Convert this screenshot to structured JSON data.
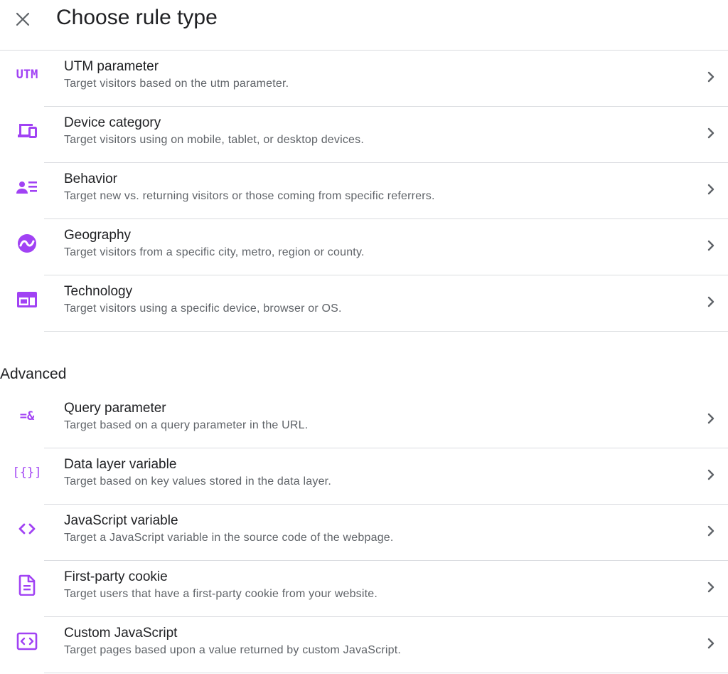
{
  "dialog": {
    "title": "Choose rule type",
    "close_icon": "close-icon"
  },
  "accent_color": "#a142f4",
  "rules": [
    {
      "icon": "utm-icon",
      "icon_text": "UTM",
      "title": "UTM parameter",
      "description": "Target visitors based on the utm parameter."
    },
    {
      "icon": "devices-icon",
      "title": "Device category",
      "description": "Target visitors using on mobile, tablet, or desktop devices."
    },
    {
      "icon": "person-list-icon",
      "title": "Behavior",
      "description": "Target new vs. returning visitors or those coming from specific referrers."
    },
    {
      "icon": "globe-icon",
      "title": "Geography",
      "description": "Target visitors from a specific city, metro, region or county."
    },
    {
      "icon": "browser-window-icon",
      "title": "Technology",
      "description": "Target visitors using a specific device, browser or OS."
    }
  ],
  "advanced": {
    "label": "Advanced",
    "rules": [
      {
        "icon": "query-parameter-icon",
        "icon_text": "=&",
        "title": "Query parameter",
        "description": "Target based on a query parameter in the URL."
      },
      {
        "icon": "data-layer-icon",
        "icon_text": "[{}]",
        "title": "Data layer variable",
        "description": "Target based on key values stored in the data layer."
      },
      {
        "icon": "code-icon",
        "title": "JavaScript variable",
        "description": "Target a JavaScript variable in the source code of the webpage."
      },
      {
        "icon": "document-icon",
        "title": "First-party cookie",
        "description": "Target users that have a first-party cookie from your website."
      },
      {
        "icon": "custom-code-icon",
        "title": "Custom JavaScript",
        "description": "Target pages based upon a value returned by custom JavaScript."
      }
    ]
  }
}
